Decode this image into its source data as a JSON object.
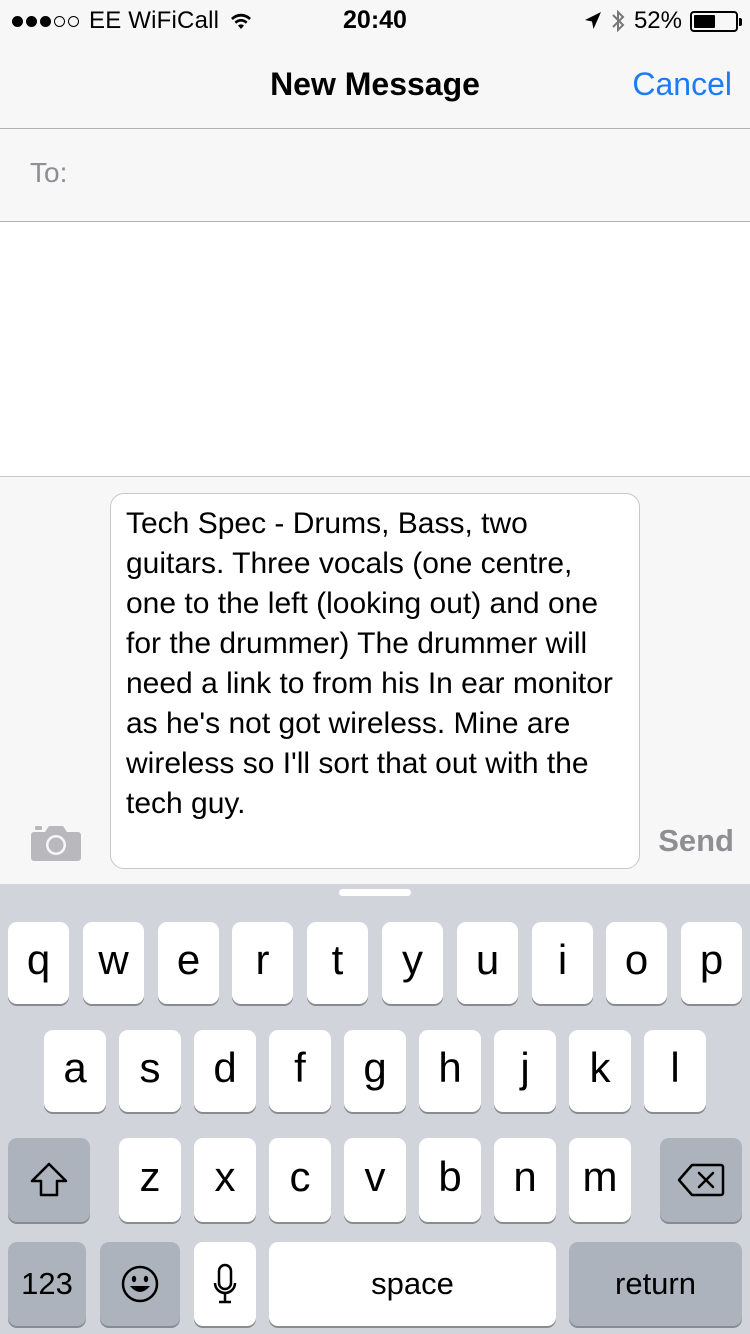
{
  "status_bar": {
    "carrier": "EE WiFiCall",
    "time": "20:40",
    "battery_text": "52%",
    "battery_level": 0.52,
    "signal_bars_filled": 3,
    "signal_bars_total": 5
  },
  "nav": {
    "title": "New Message",
    "cancel_label": "Cancel",
    "accent_color": "#1b7cf6"
  },
  "recipient": {
    "label": "To:",
    "value": ""
  },
  "compose": {
    "message": "Tech Spec - Drums, Bass, two guitars. Three vocals (one centre, one to the left (looking out) and one for the drummer) The drummer will need a link to from his In ear monitor as he's not got wireless. Mine are wireless so I'll sort that out with the tech guy.",
    "send_label": "Send",
    "camera_icon": "camera-icon"
  },
  "keyboard": {
    "row1": [
      "q",
      "w",
      "e",
      "r",
      "t",
      "y",
      "u",
      "i",
      "o",
      "p"
    ],
    "row2": [
      "a",
      "s",
      "d",
      "f",
      "g",
      "h",
      "j",
      "k",
      "l"
    ],
    "row3": [
      "z",
      "x",
      "c",
      "v",
      "b",
      "n",
      "m"
    ],
    "numbers_label": "123",
    "space_label": "space",
    "return_label": "return",
    "shift_icon": "shift-icon",
    "delete_icon": "delete-icon",
    "emoji_icon": "emoji-icon",
    "mic_icon": "microphone-icon"
  }
}
